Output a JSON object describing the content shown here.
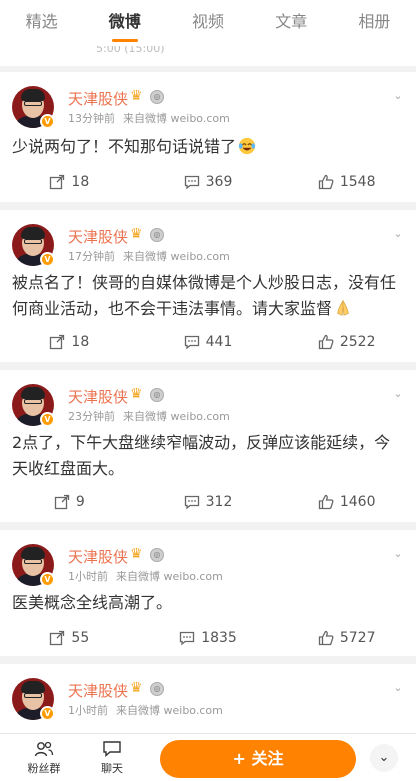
{
  "tabs": [
    {
      "label": "精选",
      "active": false
    },
    {
      "label": "微博",
      "active": true
    },
    {
      "label": "视频",
      "active": false
    },
    {
      "label": "文章",
      "active": false
    },
    {
      "label": "相册",
      "active": false
    }
  ],
  "top_remnant_text": "5:00 (15:00)",
  "colors": {
    "accent": "#ff8200",
    "name": "#eb7350"
  },
  "posts": [
    {
      "author": "天津股侠",
      "time": "13分钟前",
      "source": "来自微博 weibo.com",
      "text": "少说两句了！不知那句话说错了",
      "emoji": "laughing-tears",
      "reposts": "18",
      "comments": "369",
      "likes": "1548"
    },
    {
      "author": "天津股侠",
      "time": "17分钟前",
      "source": "来自微博 weibo.com",
      "text": "被点名了！侠哥的自媒体微博是个人炒股日志，没有任何商业活动，也不会干违法事情。请大家监督",
      "emoji": "praying-hands",
      "reposts": "18",
      "comments": "441",
      "likes": "2522"
    },
    {
      "author": "天津股侠",
      "time": "23分钟前",
      "source": "来自微博 weibo.com",
      "text": "2点了，下午大盘继续窄幅波动，反弹应该能延续，今天收红盘面大。",
      "emoji": "",
      "reposts": "9",
      "comments": "312",
      "likes": "1460"
    },
    {
      "author": "天津股侠",
      "time": "1小时前",
      "source": "来自微博 weibo.com",
      "text": "医美概念全线高潮了。",
      "emoji": "",
      "reposts": "55",
      "comments": "1835",
      "likes": "5727"
    },
    {
      "author": "天津股侠",
      "time": "1小时前",
      "source": "来自微博 weibo.com",
      "text": "",
      "emoji": "",
      "reposts": "",
      "comments": "",
      "likes": ""
    }
  ],
  "bottom_bar": {
    "fans_group": "粉丝群",
    "chat": "聊天",
    "follow": "+ 关注"
  }
}
